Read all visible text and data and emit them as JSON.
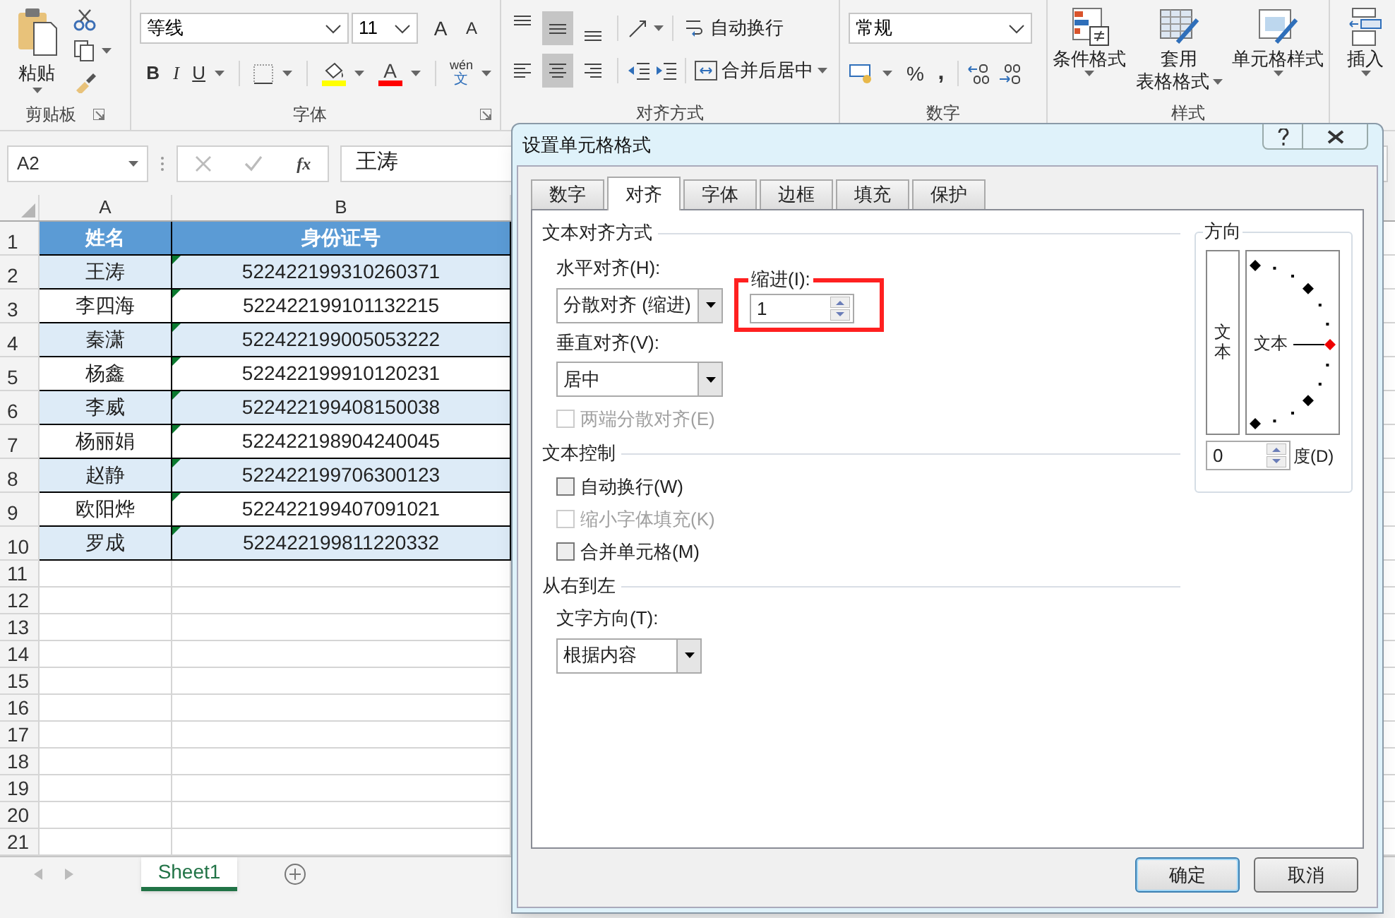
{
  "ribbon": {
    "clipboard": {
      "label": "剪贴板",
      "paste": "粘贴"
    },
    "font": {
      "label": "字体",
      "font_name": "等线",
      "font_size": "11",
      "grow_font": "A",
      "shrink_font": "A",
      "bold": "B",
      "italic": "I",
      "underline": "U",
      "font_color": "A",
      "phonetic_top": "wén",
      "phonetic_bottom": "文"
    },
    "alignment": {
      "label": "对齐方式",
      "vertical_buttons": [
        {
          "kind": "top",
          "selected": false
        },
        {
          "kind": "middle",
          "selected": true
        },
        {
          "kind": "bottom",
          "selected": false
        }
      ],
      "horizontal_buttons": [
        {
          "kind": "left",
          "selected": false
        },
        {
          "kind": "center",
          "selected": true
        },
        {
          "kind": "right",
          "selected": false
        }
      ],
      "wrap_text": "自动换行",
      "merge_center": "合并后居中"
    },
    "number": {
      "label": "数字",
      "format": "常规",
      "percent": "%",
      "comma": ","
    },
    "styles": {
      "label": "样式",
      "conditional_formatting": "条件格式",
      "format_as_table": [
        "套用",
        "表格格式"
      ],
      "cell_styles": "单元格样式"
    },
    "cells": {
      "insert": "插入"
    }
  },
  "formula_bar": {
    "name_box": "A2",
    "function_label": "fx",
    "value": "王涛"
  },
  "sheet": {
    "columns": [
      "A",
      "B"
    ],
    "rows": [
      {
        "number": "1",
        "kind": "header",
        "cells": [
          "姓名",
          "身份证号"
        ]
      },
      {
        "number": "2",
        "kind": "data",
        "cells": [
          "王涛",
          "522422199310260371"
        ]
      },
      {
        "number": "3",
        "kind": "data",
        "cells": [
          "李四海",
          "522422199101132215"
        ]
      },
      {
        "number": "4",
        "kind": "data",
        "cells": [
          "秦潇",
          "522422199005053222"
        ]
      },
      {
        "number": "5",
        "kind": "data",
        "cells": [
          "杨鑫",
          "522422199910120231"
        ]
      },
      {
        "number": "6",
        "kind": "data",
        "cells": [
          "李威",
          "522422199408150038"
        ]
      },
      {
        "number": "7",
        "kind": "data",
        "cells": [
          "杨丽娟",
          "522422198904240045"
        ]
      },
      {
        "number": "8",
        "kind": "data",
        "cells": [
          "赵静",
          "522422199706300123"
        ]
      },
      {
        "number": "9",
        "kind": "data",
        "cells": [
          "欧阳烨",
          "522422199407091021"
        ]
      },
      {
        "number": "10",
        "kind": "data",
        "cells": [
          "罗成",
          "522422199811220332"
        ]
      }
    ],
    "empty_rows": [
      "11",
      "12",
      "13",
      "14",
      "15",
      "16",
      "17",
      "18",
      "19",
      "20",
      "21"
    ]
  },
  "sheet_tabs": [
    {
      "label": "Sheet1",
      "selected": true
    }
  ],
  "dialog": {
    "title": "设置单元格格式",
    "tabs": [
      {
        "label": "数字",
        "selected": false
      },
      {
        "label": "对齐",
        "selected": true
      },
      {
        "label": "字体",
        "selected": false
      },
      {
        "label": "边框",
        "selected": false
      },
      {
        "label": "填充",
        "selected": false
      },
      {
        "label": "保护",
        "selected": false
      }
    ],
    "text_alignment": {
      "title": "文本对齐方式",
      "horizontal": {
        "label": "水平对齐(H):",
        "value": "分散对齐 (缩进)"
      },
      "indent": {
        "label": "缩进(I):",
        "value": "1"
      },
      "vertical": {
        "label": "垂直对齐(V):",
        "value": "居中"
      },
      "justify_distributed": {
        "label": "两端分散对齐(E)",
        "checked": false,
        "disabled": true
      }
    },
    "text_control": {
      "title": "文本控制",
      "options": [
        {
          "label": "自动换行(W)",
          "checked": false,
          "disabled": false
        },
        {
          "label": "缩小字体填充(K)",
          "checked": false,
          "disabled": true
        },
        {
          "label": "合并单元格(M)",
          "checked": false,
          "disabled": false
        }
      ]
    },
    "right_to_left": {
      "title": "从右到左",
      "direction": {
        "label": "文字方向(T):",
        "value": "根据内容"
      }
    },
    "orientation": {
      "title": "方向",
      "vertical_text": "文本",
      "dial_text": "文本",
      "degrees": {
        "value": "0",
        "label": "度(D)"
      }
    },
    "buttons": [
      {
        "label": "确定",
        "kind": "default"
      },
      {
        "label": "取消",
        "kind": "normal"
      }
    ]
  }
}
